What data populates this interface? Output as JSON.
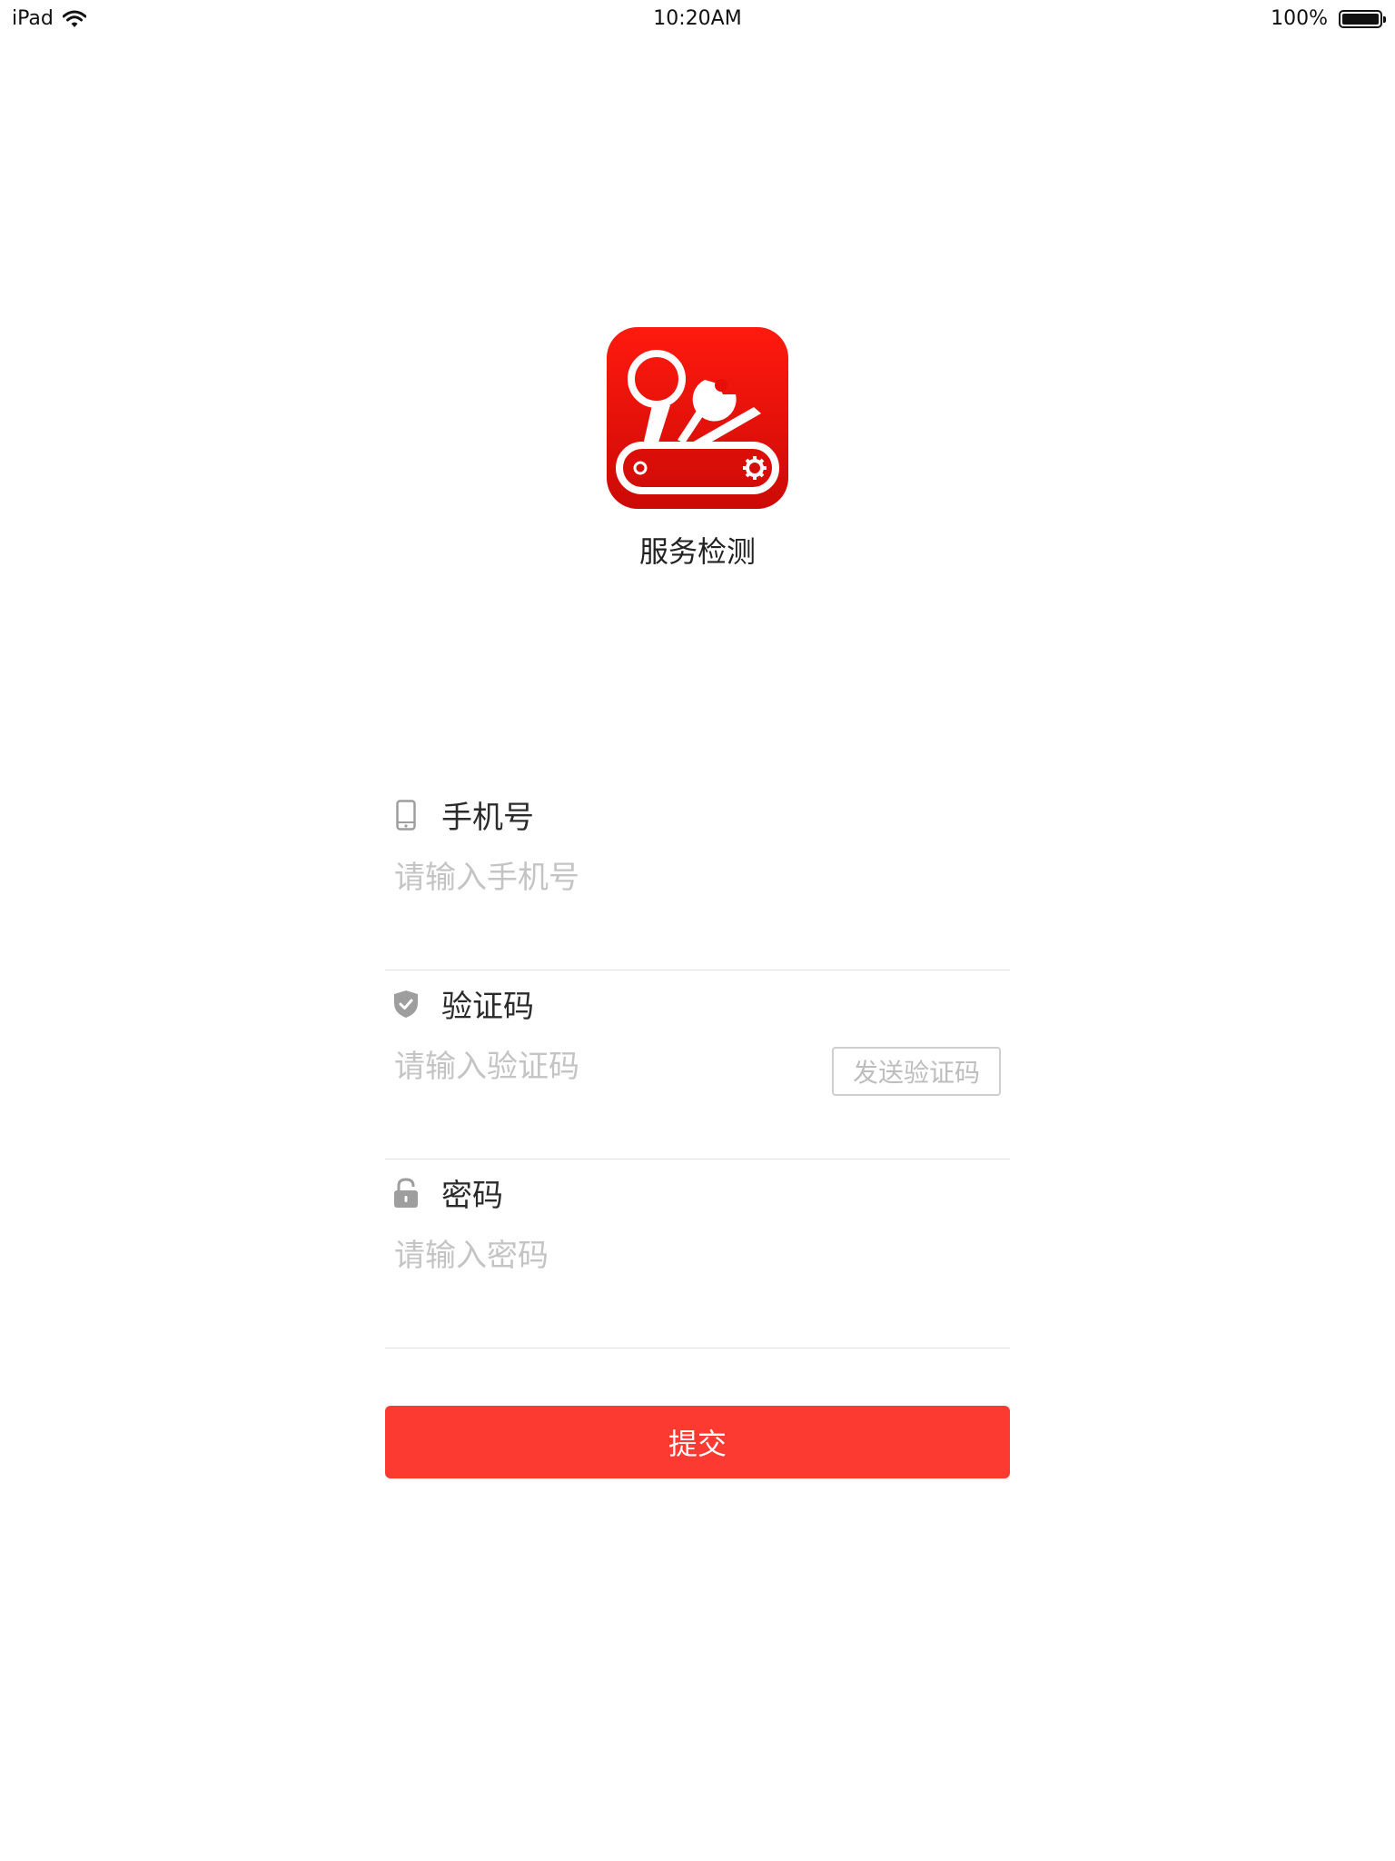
{
  "status_bar": {
    "device": "iPad",
    "time": "10:20AM",
    "battery": "100%"
  },
  "app": {
    "name": "服务检测",
    "icon": "swiss-army-knife-icon"
  },
  "form": {
    "phone": {
      "label": "手机号",
      "placeholder": "请输入手机号",
      "icon": "phone-icon"
    },
    "code": {
      "label": "验证码",
      "placeholder": "请输入验证码",
      "icon": "shield-icon",
      "send_label": "发送验证码"
    },
    "password": {
      "label": "密码",
      "placeholder": "请输入密码",
      "icon": "lock-icon"
    }
  },
  "submit_label": "提交",
  "colors": {
    "accent": "#fd3a32",
    "icon_red": "#e80f0a",
    "placeholder": "#c4c4c4",
    "divider": "#e2e2e2"
  }
}
